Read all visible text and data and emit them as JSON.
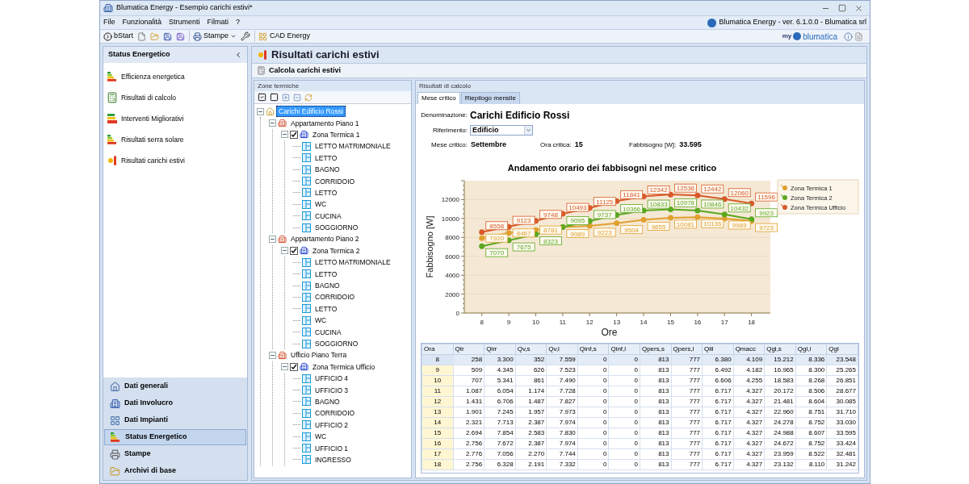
{
  "window": {
    "title": "Blumatica Energy - Esempio carichi estivi*",
    "product": "Blumatica Energy - ver. 6.1.0.0 - Blumatica srl"
  },
  "menu": [
    "File",
    "Funzionalità",
    "Strumenti",
    "Filmati",
    "?"
  ],
  "toolbar": {
    "start": "bStart",
    "print": "Stampe",
    "cad": "CAD Energy",
    "brand_prefix": "my",
    "brand": "blumatica"
  },
  "sidebar": {
    "title": "Status Energetico",
    "items": [
      "Efficienza energetica",
      "Risultati di calcolo",
      "Interventi Migliorativi",
      "Risultati serra solare",
      "Risultati carichi estivi"
    ],
    "nav": [
      {
        "label": "Dati generali",
        "selected": false
      },
      {
        "label": "Dati Involucro",
        "selected": false
      },
      {
        "label": "Dati Impianti",
        "selected": false
      },
      {
        "label": "Status Energetico",
        "selected": true
      },
      {
        "label": "Stampe",
        "selected": false
      },
      {
        "label": "Archivi di base",
        "selected": false
      }
    ]
  },
  "page": {
    "title": "Risultati carichi estivi",
    "action": "Calcola carichi estivi"
  },
  "tree_panel": {
    "title": "Zone termiche",
    "tree": [
      {
        "label": "Carichi Edificio Rossi",
        "selected": true,
        "expanded": true,
        "children": [
          {
            "label": "Appartamento Piano 1",
            "selected": false,
            "expanded": true,
            "children": [
              {
                "label": "Zona Termica 1",
                "selected": false,
                "expanded": true,
                "checked": true,
                "children": [
                  {
                    "label": "LETTO MATRIMONIALE",
                    "selected": false
                  },
                  {
                    "label": "LETTO",
                    "selected": false
                  },
                  {
                    "label": "BAGNO",
                    "selected": false
                  },
                  {
                    "label": "CORRIDOIO",
                    "selected": false
                  },
                  {
                    "label": "LETTO",
                    "selected": false
                  },
                  {
                    "label": "WC",
                    "selected": false
                  },
                  {
                    "label": "CUCINA",
                    "selected": false
                  },
                  {
                    "label": "SOGGIORNO",
                    "selected": false
                  }
                ]
              }
            ]
          },
          {
            "label": "Appartamento Piano 2",
            "selected": false,
            "expanded": true,
            "children": [
              {
                "label": "Zona Termica 2",
                "selected": false,
                "expanded": true,
                "checked": true,
                "children": [
                  {
                    "label": "LETTO MATRIMONIALE",
                    "selected": false
                  },
                  {
                    "label": "LETTO",
                    "selected": false
                  },
                  {
                    "label": "BAGNO",
                    "selected": false
                  },
                  {
                    "label": "CORRIDOIO",
                    "selected": false
                  },
                  {
                    "label": "LETTO",
                    "selected": false
                  },
                  {
                    "label": "WC",
                    "selected": false
                  },
                  {
                    "label": "CUCINA",
                    "selected": false
                  },
                  {
                    "label": "SOGGIORNO",
                    "selected": false
                  }
                ]
              }
            ]
          },
          {
            "label": "Ufficio Piano Terra",
            "selected": false,
            "expanded": true,
            "children": [
              {
                "label": "Zona Termica Ufficio",
                "selected": false,
                "expanded": true,
                "checked": true,
                "children": [
                  {
                    "label": "UFFICIO 4",
                    "selected": false
                  },
                  {
                    "label": "UFFICIO 3",
                    "selected": false
                  },
                  {
                    "label": "BAGNO",
                    "selected": false
                  },
                  {
                    "label": "CORRIDOIO",
                    "selected": false
                  },
                  {
                    "label": "UFFICIO 2",
                    "selected": false
                  },
                  {
                    "label": "WC",
                    "selected": false
                  },
                  {
                    "label": "UFFICIO 1",
                    "selected": false
                  },
                  {
                    "label": "INGRESSO",
                    "selected": false
                  }
                ]
              }
            ]
          }
        ]
      }
    ]
  },
  "results": {
    "title": "Risultati di calcolo",
    "tabs": [
      {
        "label": "Mese critico",
        "selected": true
      },
      {
        "label": "Riepilogo mensile",
        "selected": false
      }
    ],
    "denominazione": {
      "label": "Denominazione:",
      "value": "Carichi Edificio Rossi"
    },
    "riferimento": {
      "label": "Riferimento:",
      "value": "Edificio"
    },
    "summary": [
      {
        "label": "Mese critico:",
        "value": "Settembre"
      },
      {
        "label": "Ora critica:",
        "value": "15"
      },
      {
        "label": "Fabbisogno [W]:",
        "value": "33.595"
      }
    ],
    "chart_data": {
      "type": "line",
      "title": "Andamento orario dei fabbisogni nel mese critico",
      "xlabel": "Ore",
      "ylabel": "Fabbisogno [W]",
      "x": [
        8,
        9,
        10,
        11,
        12,
        13,
        14,
        15,
        16,
        17,
        18
      ],
      "series": [
        {
          "name": "Zona Termica 1",
          "color": "#e0a030",
          "marker": "circle",
          "values": [
            7920,
            8467,
            8781,
            9089,
            9223,
            9504,
            9855,
            10081,
            10136,
            9989,
            9723
          ]
        },
        {
          "name": "Zona Termica 2",
          "color": "#5aa820",
          "marker": "circle",
          "values": [
            7070,
            7675,
            8323,
            9095,
            9737,
            10366,
            10833,
            10978,
            10846,
            10432,
            9923
          ]
        },
        {
          "name": "Zona Termica Ufficio",
          "color": "#d85a2a",
          "marker": "circle",
          "values": [
            8558,
            9123,
            9748,
            10493,
            11125,
            11841,
            12342,
            12536,
            12442,
            12060,
            11596
          ]
        }
      ],
      "xlim": [
        7.35,
        18.7
      ],
      "ylim": [
        0,
        14000
      ],
      "xticks": [
        {
          "value": 8,
          "label": "8"
        },
        {
          "value": 9,
          "label": "9"
        },
        {
          "value": 10,
          "label": "10"
        },
        {
          "value": 11,
          "label": "11"
        },
        {
          "value": 12,
          "label": "12"
        },
        {
          "value": 13,
          "label": "13"
        },
        {
          "value": 14,
          "label": "14"
        },
        {
          "value": 15,
          "label": "15"
        },
        {
          "value": 16,
          "label": "16"
        },
        {
          "value": 17,
          "label": "17"
        },
        {
          "value": 18,
          "label": "18"
        }
      ],
      "yticks": [
        0,
        2000,
        4000,
        6000,
        8000,
        10000,
        12000
      ],
      "data_labels": true,
      "grid": true,
      "legend": true
    },
    "table": {
      "columns": [
        "Ora",
        "Qtr",
        "Qirr",
        "Qv,s",
        "Qv,l",
        "Qinf,s",
        "Qinf,l",
        "Qpers,s",
        "Qpers,l",
        "Qill",
        "Qmacc",
        "Qgl,s",
        "Qgl,l",
        "Qgl"
      ],
      "rows": [
        {
          "selected": true,
          "cells": [
            "8",
            "258",
            "3.300",
            "352",
            "7.559",
            "0",
            "0",
            "813",
            "777",
            "6.380",
            "4.109",
            "15.212",
            "8.336",
            "23.548"
          ]
        },
        {
          "selected": false,
          "cells": [
            "9",
            "509",
            "4.345",
            "626",
            "7.523",
            "0",
            "0",
            "813",
            "777",
            "6.492",
            "4.182",
            "16.965",
            "8.300",
            "25.265"
          ]
        },
        {
          "selected": false,
          "cells": [
            "10",
            "707",
            "5.341",
            "861",
            "7.490",
            "0",
            "0",
            "813",
            "777",
            "6.606",
            "4.255",
            "18.583",
            "8.268",
            "26.851"
          ]
        },
        {
          "selected": false,
          "cells": [
            "11",
            "1.087",
            "6.054",
            "1.174",
            "7.728",
            "0",
            "0",
            "813",
            "777",
            "6.717",
            "4.327",
            "20.172",
            "8.506",
            "28.677"
          ]
        },
        {
          "selected": false,
          "cells": [
            "12",
            "1.431",
            "6.706",
            "1.487",
            "7.827",
            "0",
            "0",
            "813",
            "777",
            "6.717",
            "4.327",
            "21.481",
            "8.604",
            "30.085"
          ]
        },
        {
          "selected": false,
          "cells": [
            "13",
            "1.901",
            "7.245",
            "1.957",
            "7.973",
            "0",
            "0",
            "813",
            "777",
            "6.717",
            "4.327",
            "22.960",
            "8.751",
            "31.710"
          ]
        },
        {
          "selected": false,
          "cells": [
            "14",
            "2.321",
            "7.713",
            "2.387",
            "7.974",
            "0",
            "0",
            "813",
            "777",
            "6.717",
            "4.327",
            "24.278",
            "8.752",
            "33.030"
          ]
        },
        {
          "selected": false,
          "cells": [
            "15",
            "2.694",
            "7.854",
            "2.583",
            "7.830",
            "0",
            "0",
            "813",
            "777",
            "6.717",
            "4.327",
            "24.988",
            "8.607",
            "33.595"
          ]
        },
        {
          "selected": false,
          "cells": [
            "16",
            "2.756",
            "7.672",
            "2.387",
            "7.974",
            "0",
            "0",
            "813",
            "777",
            "6.717",
            "4.327",
            "24.672",
            "8.752",
            "33.424"
          ]
        },
        {
          "selected": false,
          "cells": [
            "17",
            "2.776",
            "7.056",
            "2.270",
            "7.744",
            "0",
            "0",
            "813",
            "777",
            "6.717",
            "4.327",
            "23.959",
            "8.522",
            "32.481"
          ]
        },
        {
          "selected": false,
          "cells": [
            "18",
            "2.756",
            "6.328",
            "2.191",
            "7.332",
            "0",
            "0",
            "813",
            "777",
            "6.717",
            "4.327",
            "23.132",
            "8.110",
            "31.242"
          ]
        }
      ]
    }
  }
}
